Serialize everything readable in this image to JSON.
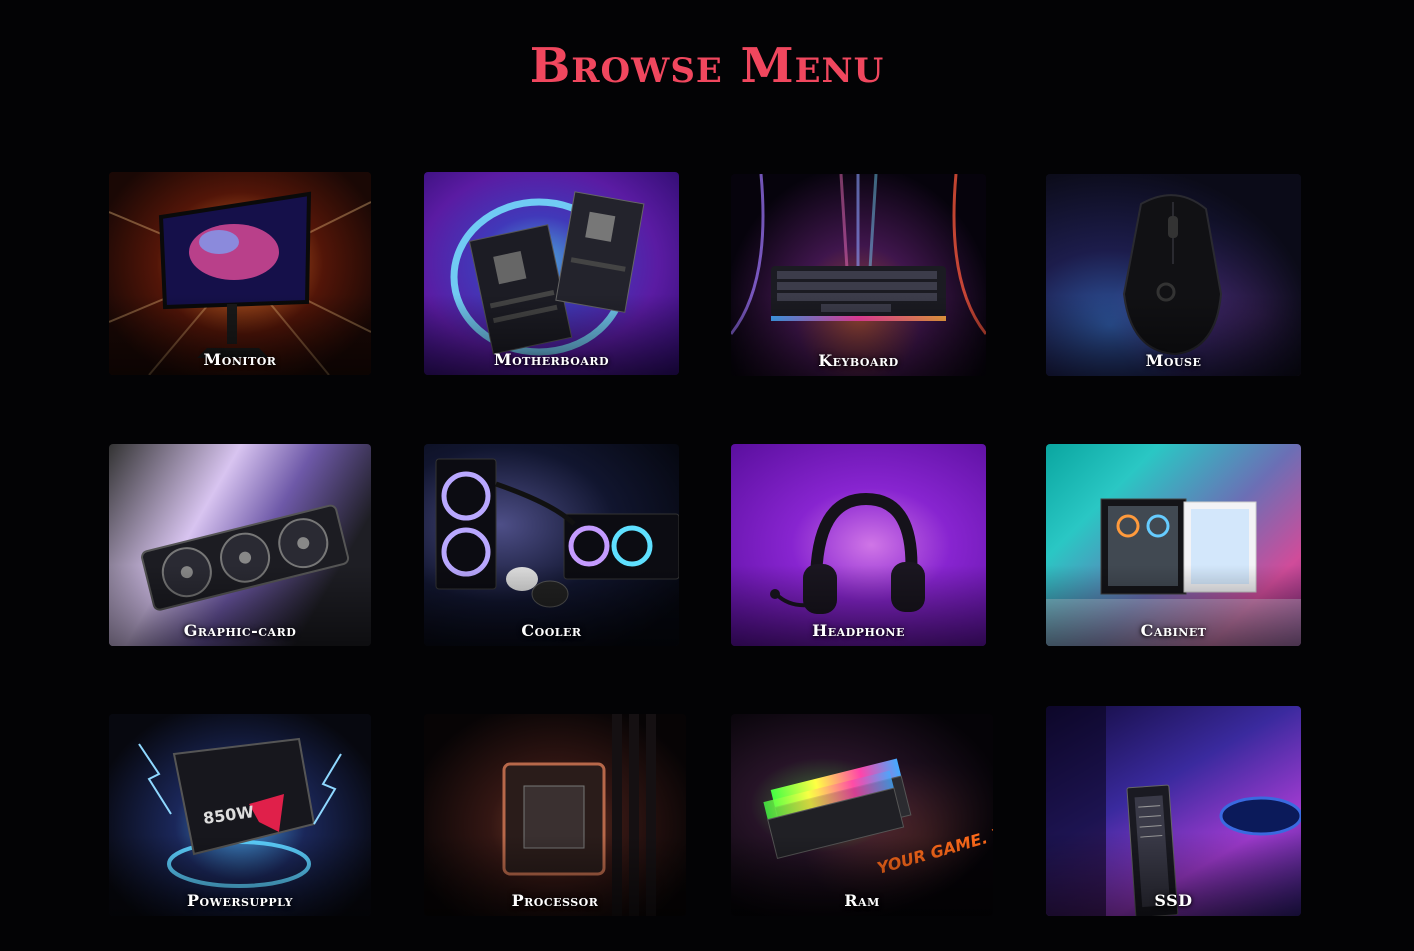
{
  "page_title": "Browse Menu",
  "categories": [
    {
      "label": "Monitor"
    },
    {
      "label": "Motherboard"
    },
    {
      "label": "Keyboard"
    },
    {
      "label": "Mouse"
    },
    {
      "label": "Graphic-card"
    },
    {
      "label": "Cooler"
    },
    {
      "label": "Headphone"
    },
    {
      "label": "Cabinet"
    },
    {
      "label": "Powersupply"
    },
    {
      "label": "Processor"
    },
    {
      "label": "Ram"
    },
    {
      "label": "SSD"
    }
  ],
  "ram_art_text": "YOUR GAME. YOUR WAY.",
  "psu_art_text": "850W",
  "colors": {
    "background": "#030305",
    "title": "#f0475e",
    "label": "#ffffff"
  }
}
